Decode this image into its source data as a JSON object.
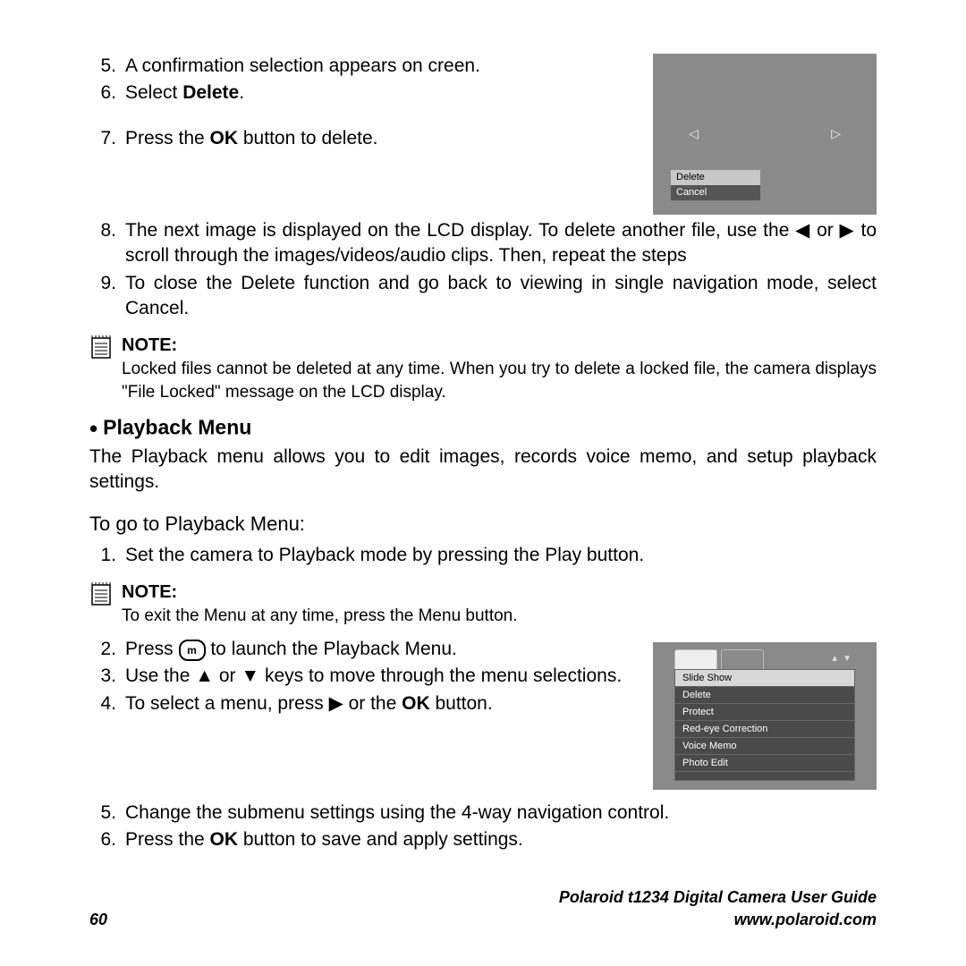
{
  "steps_a": {
    "s5_num": "5.",
    "s5": "A confirmation selection appears on creen.",
    "s6_num": "6.",
    "s6_pre": "Select ",
    "s6_bold": "Delete",
    "s6_post": ".",
    "s7_num": "7.",
    "s7_pre": "Press the ",
    "s7_bold": "OK",
    "s7_post": " button to delete."
  },
  "delete_fig": {
    "nav_left": "◁",
    "nav_right": "▷",
    "opt1": "Delete",
    "opt2": "Cancel"
  },
  "steps_b": {
    "s8_num": "8.",
    "s8": "The next image is displayed on the LCD display. To delete another file, use the ◀ or ▶ to scroll through the images/videos/audio clips. Then, repeat the steps",
    "s9_num": "9.",
    "s9": "To close the Delete function and go back to viewing in single navigation mode, select Cancel."
  },
  "note1": {
    "label": "NOTE:",
    "text": "Locked files cannot be deleted at any time. When you try to delete a locked file, the camera displays \"File Locked\" message on the LCD display."
  },
  "section": {
    "bullet": "•",
    "title": "Playback Menu",
    "intro": "The Playback menu allows you to edit images, records voice memo, and setup playback settings.",
    "subhead": "To go to Playback Menu:"
  },
  "steps_c": {
    "s1_num": "1.",
    "s1": "Set the camera to Playback mode by pressing the Play button."
  },
  "note2": {
    "label": "NOTE:",
    "text": "To exit the Menu at any time, press the Menu button."
  },
  "steps_d": {
    "s2_num": "2.",
    "s2_pre": "Press ",
    "s2_btn": "m",
    "s2_post": " to launch the Playback Menu.",
    "s3_num": "3.",
    "s3": "Use the ▲ or ▼ keys to move through the menu selections.",
    "s4_num": "4.",
    "s4_pre": "To select a menu, press ▶ or the ",
    "s4_bold": "OK",
    "s4_post": " button."
  },
  "menu_fig": {
    "scroll": "▲▼",
    "items": [
      "Slide Show",
      "Delete",
      "Protect",
      "Red-eye Correction",
      "Voice Memo",
      "Photo Edit"
    ]
  },
  "steps_e": {
    "s5_num": "5.",
    "s5": "Change the submenu settings using the 4-way navigation control.",
    "s6_num": "6.",
    "s6_pre": "Press the ",
    "s6_bold": "OK",
    "s6_post": " button to save and apply settings."
  },
  "footer": {
    "page": "60",
    "title": "Polaroid t1234 Digital Camera User Guide",
    "url": "www.polaroid.com"
  }
}
